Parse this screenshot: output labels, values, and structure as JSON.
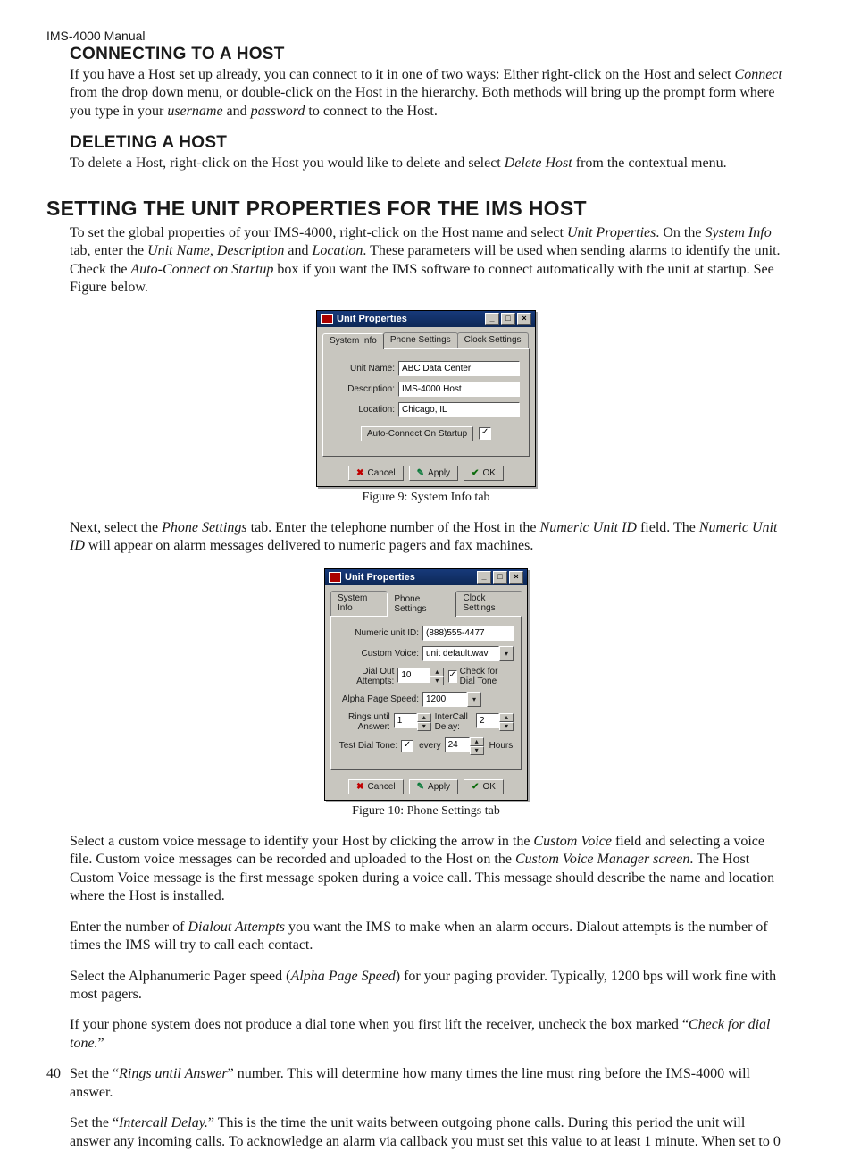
{
  "running_head": "IMS-4000 Manual",
  "page_number": "40",
  "sec_connect": {
    "heading": "Connecting to a Host",
    "p1a": "If you have a Host set up already, you can connect to it in one of two ways: Either right-click on the Host and select ",
    "p1b_em": "Connect",
    "p1c": " from the drop down menu, or double-click on the Host in the hierarchy. Both methods will bring up the prompt form where you type in your ",
    "p1d_em": "username",
    "p1e": " and ",
    "p1f_em": "password",
    "p1g": " to connect to the Host."
  },
  "sec_delete": {
    "heading": "Deleting a Host",
    "p1a": "To delete a Host, right-click on the Host you would like to delete and select ",
    "p1b_em": "Delete Host",
    "p1c": " from the contextual menu."
  },
  "sec_props": {
    "heading": "Setting the Unit Properties for the IMS Host",
    "p1a": "To set the global properties of your IMS-4000, right-click on the Host name and select ",
    "p1b_em": "Unit Properties",
    "p1c": ". On the ",
    "p1d_em": "System Info",
    "p1e": " tab, enter the ",
    "p1f_em": "Unit Name, Description",
    "p1g": " and ",
    "p1h_em": "Location",
    "p1i": ". These parameters will be used when sending alarms to identify the unit. Check the ",
    "p1j_em": "Auto-Connect on Startup",
    "p1k": " box if you want the IMS software to connect automatically with the unit at startup. See Figure below."
  },
  "fig9_caption": "Figure 9: System Info tab",
  "dlg1": {
    "title": "Unit Properties",
    "tabs": [
      "System Info",
      "Phone Settings",
      "Clock Settings"
    ],
    "active_tab": 0,
    "unit_name_lbl": "Unit Name:",
    "unit_name_val": "ABC Data Center",
    "description_lbl": "Description:",
    "description_val": "IMS-4000 Host",
    "location_lbl": "Location:",
    "location_val": "Chicago, IL",
    "auto_connect_lbl": "Auto-Connect On Startup",
    "auto_connect_checked": true,
    "btn_cancel": "Cancel",
    "btn_apply": "Apply",
    "btn_ok": "OK"
  },
  "para_next": {
    "a": "Next, select the ",
    "b_em": "Phone Settings",
    "c": " tab. Enter the telephone number of the Host in the ",
    "d_em": "Numeric Unit ID",
    "e": " field. The ",
    "f_em": "Numeric Unit ID",
    "g": " will appear on alarm messages delivered to numeric pagers and fax machines."
  },
  "dlg2": {
    "title": "Unit Properties",
    "tabs": [
      "System Info",
      "Phone Settings",
      "Clock Settings"
    ],
    "active_tab": 1,
    "numeric_lbl": "Numeric unit ID:",
    "numeric_val": "(888)555-4477",
    "custom_voice_lbl": "Custom Voice:",
    "custom_voice_val": "unit default.wav",
    "dialout_lbl": "Dial Out Attempts:",
    "dialout_val": "10",
    "check_dialtone_lbl": "Check for Dial Tone",
    "check_dialtone_checked": true,
    "alpha_lbl": "Alpha Page Speed:",
    "alpha_val": "1200",
    "rings_lbl": "Rings until Answer:",
    "rings_val": "1",
    "intercall_lbl": "InterCall Delay:",
    "intercall_val": "2",
    "test_lbl": "Test Dial Tone:",
    "test_checked": true,
    "every_lbl": "every",
    "every_val": "24",
    "hours_lbl": "Hours",
    "btn_cancel": "Cancel",
    "btn_apply": "Apply",
    "btn_ok": "OK"
  },
  "fig10_caption": "Figure 10: Phone Settings tab",
  "para_custom": {
    "a": "Select a custom voice message to identify your Host by clicking the arrow in the ",
    "b_em": "Custom Voice",
    "c": " field and selecting a voice file. Custom voice messages can be recorded and uploaded to the Host on the ",
    "d_em": "Custom Voice Manager screen",
    "e": ". The Host Custom Voice message is the first message spoken during a voice call. This message should describe the name and location where the Host is installed."
  },
  "para_dialout": {
    "a": "Enter the number of ",
    "b_em": "Dialout Attempts",
    "c": " you want the IMS to make when an alarm occurs. Dialout attempts is the number of times the IMS will try to call each contact."
  },
  "para_alpha": {
    "a": "Select the Alphanumeric Pager speed (",
    "b_em": "Alpha Page Speed",
    "c": ") for your paging provider. Typically, 1200 bps will work fine with most pagers."
  },
  "para_checkdt": {
    "a": "If your phone system does not produce a dial tone when you first lift the receiver, uncheck the box marked “",
    "b_em": "Check for dial tone.",
    "c": "”"
  },
  "para_rings": {
    "a": "Set the “",
    "b_em": "Rings until Answer",
    "c": "” number. This will determine how many times the line must ring before the IMS-4000 will answer."
  },
  "para_intercall": {
    "a": "Set the “",
    "b_em": "Intercall Delay.",
    "c": "” This is the time the unit waits between outgoing phone calls. During this period the unit will answer any incoming calls. To acknowledge an alarm via callback you must set this value to at least 1 minute. When set to 0"
  }
}
